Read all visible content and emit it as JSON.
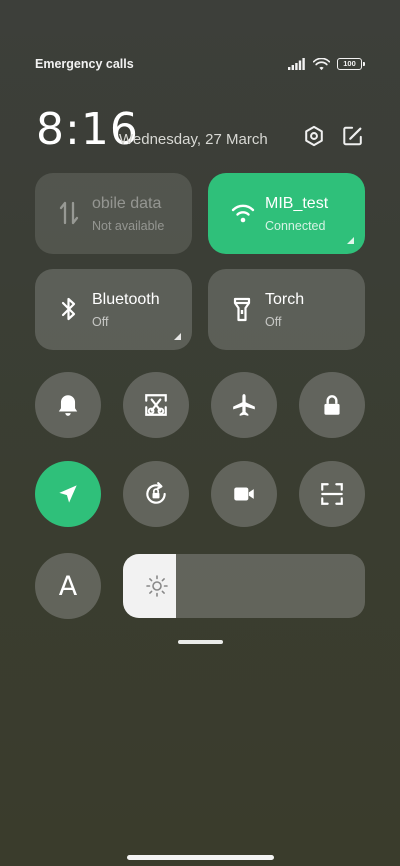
{
  "status_bar": {
    "carrier_text": "Emergency calls o",
    "battery": "100"
  },
  "header": {
    "time": "8:16",
    "date": "Wednesday, 27 March"
  },
  "tiles": {
    "mobile_data": {
      "title": "obile data",
      "subtitle": "Not available"
    },
    "wifi": {
      "title": "MIB_test",
      "subtitle": "Connected"
    },
    "bluetooth": {
      "title": "Bluetooth",
      "subtitle": "Off"
    },
    "torch": {
      "title": "Torch",
      "subtitle": "Off"
    }
  },
  "toggles_row1": [
    "bell-icon",
    "screenshot-icon",
    "airplane-icon",
    "lock-icon"
  ],
  "toggles_row2": [
    "location-icon",
    "rotation-lock-icon",
    "video-camera-icon",
    "scan-icon"
  ],
  "font_toggle_label": "A",
  "brightness": {
    "level": 0.22
  },
  "colors": {
    "accent": "#2fc07a",
    "tile": "#7a7c75",
    "background": "#3b3e34"
  }
}
